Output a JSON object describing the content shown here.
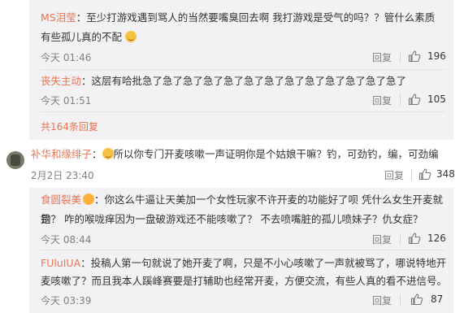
{
  "nested_top": [
    {
      "user": "MS泪莹",
      "text": "：至少打游戏遇到骂人的当然要嘴臭回去啊 我打游戏是受气的吗？？管什么素质 有些孤儿真的不配",
      "time": "今天 01:46",
      "reply": "回复",
      "likes": "196"
    },
    {
      "user": "丧失主动",
      "text": "：这层有哈批急了急了急了急了急了急了急了急了急了急了急了急了急了",
      "time": "今天 01:51",
      "reply": "回复",
      "likes": "105"
    }
  ],
  "more_link": "共164条回复",
  "main_comment": {
    "user": "补华和缘绯子",
    "text": "所以你专门开麦咳嗽一声证明你是个姑娘干嘛？钓，可劲钓，编，可劲编",
    "time": "2月2日 23:40",
    "reply": "回复",
    "likes": "348"
  },
  "nested_bottom": [
    {
      "user": "食圆裂美",
      "text_line1": "：你这么牛逼让天美加一个女性玩家不许开麦的功能好了呗 凭什么女生开麦就是",
      "text_line2": "钓？ 咋的喉咙痒因为一盘破游戏还不能咳嗽了？ 不去喷嘴脏的孤儿喷妹子？仇女症？",
      "time": "今天 08:44",
      "reply": "回复",
      "likes": "126"
    },
    {
      "user": "FUluIUA",
      "text_line1": "：投稿人第一句就说了她开麦了啊，只是不小心咳嗽了一声就被骂了，哪说特地开",
      "text_line2": "麦咳嗽了？而且我本人蹊峰赛要是打辅助也经常开麦，方便交流，有些人真的看不进信号。",
      "time": "今天 03:39",
      "reply": "回复",
      "likes": "87"
    }
  ],
  "colors": {
    "accent": "#eb7350",
    "panel": "#f2f2f5",
    "muted": "#808080"
  }
}
